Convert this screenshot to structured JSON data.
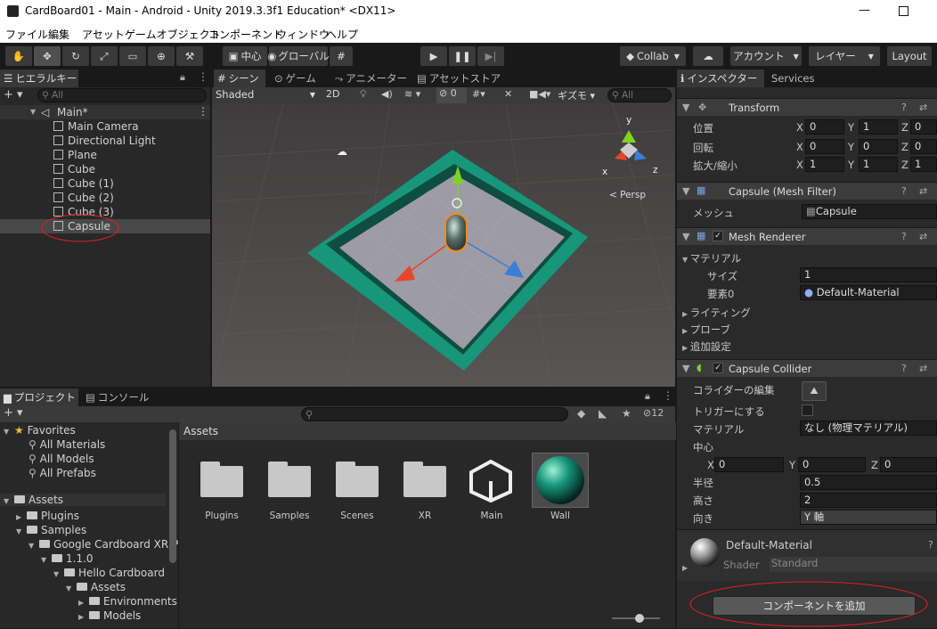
{
  "window": {
    "title": "CardBoard01 - Main - Android - Unity 2019.3.3f1 Education* <DX11>"
  },
  "menu": [
    "ファイル",
    "編集",
    "アセット",
    "ゲームオブジェクト",
    "コンポーネント",
    "ウィンドウ",
    "ヘルプ"
  ],
  "toolbar": {
    "pivot": "中心",
    "global": "グローバル",
    "collab": "Collab",
    "account": "アカウント",
    "layers": "レイヤー",
    "layout": "Layout"
  },
  "hierarchy": {
    "tab": "ヒエラルキー",
    "search_placeholder": "All",
    "scene": "Main*",
    "items": [
      "Main Camera",
      "Directional Light",
      "Plane",
      "Cube",
      "Cube (1)",
      "Cube (2)",
      "Cube (3)",
      "Capsule"
    ],
    "selected": "Capsule"
  },
  "scene_view": {
    "tabs": [
      "シーン",
      "ゲーム",
      "アニメーター",
      "アセットストア"
    ],
    "shading": "Shaded",
    "mode_2d": "2D",
    "hidden_count": "0",
    "gizmos": "ギズモ",
    "search_placeholder": "All",
    "persp": "< Persp",
    "axis_x": "x",
    "axis_y": "y",
    "axis_z": "z"
  },
  "project": {
    "tab": "プロジェクト",
    "console_tab": "コンソール",
    "hidden_count": "12",
    "favorites_label": "Favorites",
    "favorites": [
      "All Materials",
      "All Models",
      "All Prefabs"
    ],
    "assets_label": "Assets",
    "tree": [
      "Plugins",
      "Samples",
      "Google Cardboard XR Pl",
      "1.1.0",
      "Hello Cardboard",
      "Assets",
      "Environments",
      "Models"
    ],
    "breadcrumb": "Assets",
    "assets": [
      "Plugins",
      "Samples",
      "Scenes",
      "XR",
      "Main",
      "Wall"
    ]
  },
  "inspector": {
    "tab": "インスペクター",
    "services_tab": "Services",
    "transform": {
      "name": "Transform",
      "position_label": "位置",
      "rotation_label": "回転",
      "scale_label": "拡大/縮小",
      "position": [
        "0",
        "1",
        "0"
      ],
      "rotation": [
        "0",
        "0",
        "0"
      ],
      "scale": [
        "1",
        "1",
        "1"
      ]
    },
    "mesh_filter": {
      "name": "Capsule (Mesh Filter)",
      "mesh_label": "メッシュ",
      "mesh": "Capsule"
    },
    "mesh_renderer": {
      "name": "Mesh Renderer",
      "materials_label": "マテリアル",
      "size_label": "サイズ",
      "size": "1",
      "element_label": "要素0",
      "element": "Default-Material",
      "lighting": "ライティング",
      "probes": "プローブ",
      "additional": "追加設定"
    },
    "capsule_collider": {
      "name": "Capsule Collider",
      "edit_label": "コライダーの編集",
      "trigger_label": "トリガーにする",
      "material_label": "マテリアル",
      "material": "なし (物理マテリアル)",
      "center_label": "中心",
      "center": [
        "0",
        "0",
        "0"
      ],
      "radius_label": "半径",
      "radius": "0.5",
      "height_label": "高さ",
      "height": "2",
      "direction_label": "向き",
      "direction": "Y 軸"
    },
    "material": {
      "name": "Default-Material",
      "shader_label": "Shader",
      "shader": "Standard"
    },
    "add_component": "コンポーネントを追加"
  },
  "colors": {
    "annotation": "#e02020",
    "wall": "#17967a",
    "selection": "#3e5f96"
  }
}
